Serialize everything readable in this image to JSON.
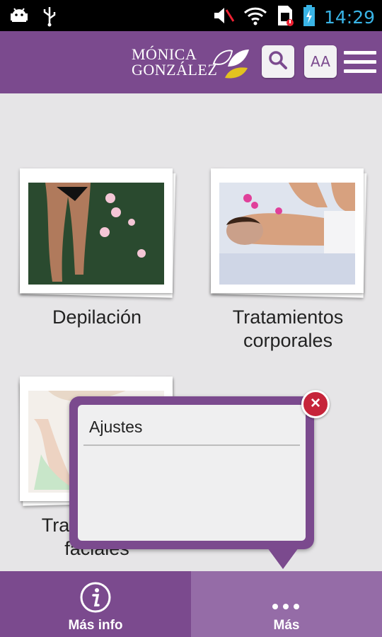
{
  "status_bar": {
    "time": "14:29",
    "icons": [
      "android-debug-icon",
      "usb-icon",
      "volume-muted-icon",
      "wifi-icon",
      "sim-alert-icon",
      "battery-charging-icon"
    ]
  },
  "header": {
    "logo_line1": "MÓNICA",
    "logo_line2": "GONZÁLEZ",
    "search_icon": "search-icon",
    "font_size_label": "AA",
    "menu_icon": "hamburger-menu-icon"
  },
  "grid": {
    "items": [
      {
        "label": "Depilación"
      },
      {
        "label": "Tratamientos corporales"
      },
      {
        "label": "Tratamientos faciales"
      }
    ]
  },
  "popup": {
    "items": [
      "Ajustes"
    ],
    "close_icon": "close-icon"
  },
  "bottom_nav": {
    "tabs": [
      {
        "label": "Más info",
        "icon": "info-icon"
      },
      {
        "label": "Más",
        "icon": "more-dots-icon"
      }
    ]
  },
  "colors": {
    "brand_purple": "#7b4a8e",
    "background": "#e6e5e7",
    "accent_yellow": "#e3c21f",
    "close_red": "#c6243a",
    "time_blue": "#39b4e6"
  }
}
